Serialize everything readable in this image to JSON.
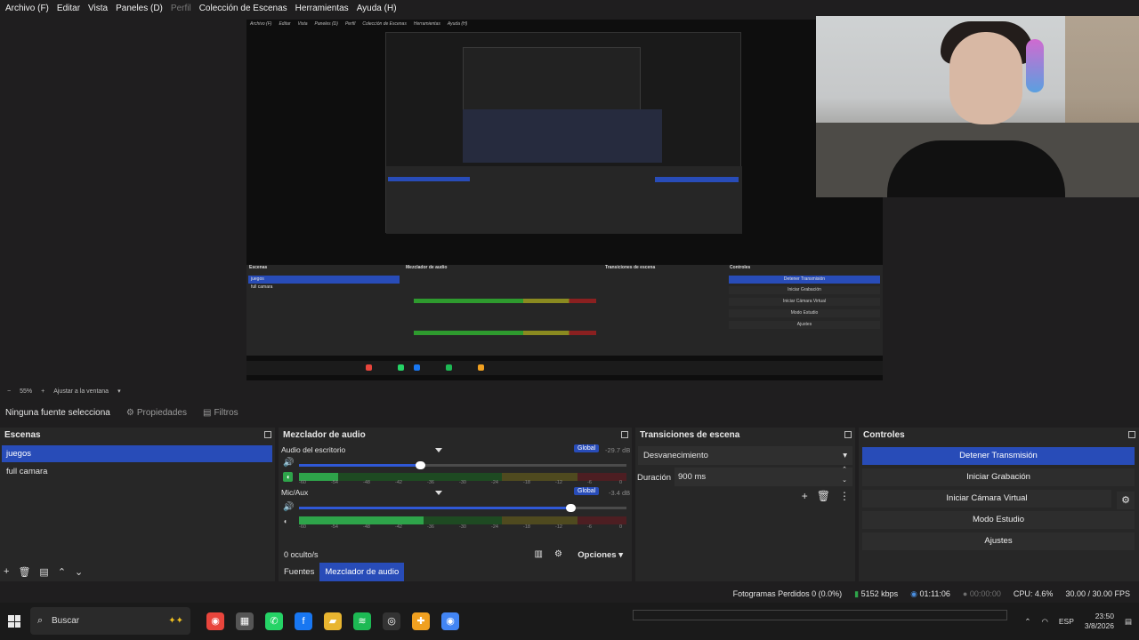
{
  "menu": {
    "items": [
      "Archivo (F)",
      "Editar",
      "Vista",
      "Paneles (D)",
      "Perfil",
      "Colección de Escenas",
      "Herramientas",
      "Ayuda (H)"
    ],
    "disabled_index": 4
  },
  "zoom": {
    "minus": "−",
    "value": "55%",
    "plus": "+",
    "fit": "Ajustar a la ventana"
  },
  "source_toolbar": {
    "no_source": "Ninguna fuente selecciona",
    "properties": "Propiedades",
    "filters": "Filtros"
  },
  "scenes": {
    "title": "Escenas",
    "items": [
      "juegos",
      "full camara"
    ],
    "active_index": 0
  },
  "mixer": {
    "title": "Mezclador de audio",
    "tracks": [
      {
        "name": "Audio del escritorio",
        "global": "Global",
        "db": "-29.7 dB",
        "volume_fraction": 0.37,
        "level_fraction": 0.12
      },
      {
        "name": "Mic/Aux",
        "global": "Global",
        "db": "-3.4 dB",
        "volume_fraction": 0.83,
        "level_fraction": 0.38
      }
    ],
    "scale": [
      "-60",
      "-54",
      "-48",
      "-42",
      "-36",
      "-30",
      "-24",
      "-18",
      "-12",
      "-6",
      "0"
    ],
    "hidden": "0 oculto/s",
    "options": "Opciones",
    "tabs": [
      "Fuentes",
      "Mezclador de audio"
    ],
    "active_tab": 1
  },
  "transitions": {
    "title": "Transiciones de escena",
    "selected": "Desvanecimiento",
    "duration_label": "Duración",
    "duration_value": "900 ms"
  },
  "controls": {
    "title": "Controles",
    "buttons": [
      "Detener Transmisión",
      "Iniciar Grabación",
      "Iniciar Cámara Virtual",
      "Modo Estudio",
      "Ajustes"
    ]
  },
  "status": {
    "dropped": "Fotogramas Perdidos 0 (0.0%)",
    "bitrate": "5152 kbps",
    "stream_time": "01:11:06",
    "rec_time": "00:00:00",
    "cpu": "CPU: 4.6%",
    "fps": "30.00 / 30.00 FPS",
    "bitrate_color": "#2ea44a"
  },
  "taskbar": {
    "search": "Buscar",
    "lang": "ESP",
    "time": "23:50",
    "date": "3/8/2026",
    "apps": [
      {
        "icon": "chrome-icon",
        "color": "#e8453c"
      },
      {
        "icon": "cpu-icon",
        "color": "#555555"
      },
      {
        "icon": "whatsapp-icon",
        "color": "#25d366"
      },
      {
        "icon": "facebook-icon",
        "color": "#1877f2"
      },
      {
        "icon": "folder-icon",
        "color": "#e8b530"
      },
      {
        "icon": "spotify-icon",
        "color": "#1db954"
      },
      {
        "icon": "obs-icon",
        "color": "#333333"
      },
      {
        "icon": "pinned-app-icon",
        "color": "#f0a020"
      },
      {
        "icon": "chrome-alt-icon",
        "color": "#4285f4"
      }
    ]
  },
  "colors": {
    "accent": "#284cb8",
    "panel": "#272727",
    "background": "#1f1e1f"
  }
}
